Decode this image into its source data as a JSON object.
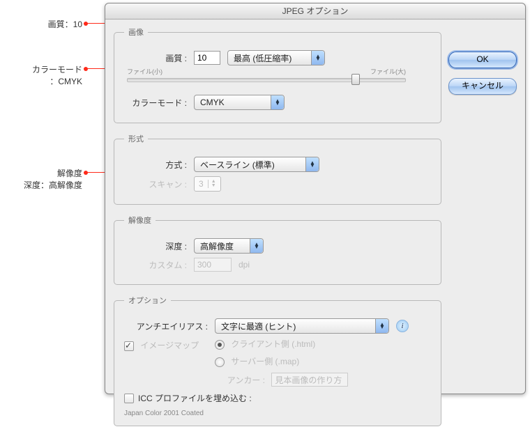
{
  "window": {
    "title": "JPEG オプション"
  },
  "callouts": {
    "quality": "画質：10",
    "colormode": "カラーモード\n：CMYK",
    "resolution": "解像度\n深度：高解像度"
  },
  "buttons": {
    "ok": "OK",
    "cancel": "キャンセル"
  },
  "image": {
    "legend": "画像",
    "quality_label": "画質 :",
    "quality_value": "10",
    "quality_preset": "最高 (低圧縮率)",
    "slider_small": "ファイル(小)",
    "slider_large": "ファイル(大)",
    "colormode_label": "カラーモード :",
    "colormode_value": "CMYK"
  },
  "format": {
    "legend": "形式",
    "method_label": "方式 :",
    "method_value": "ベースライン (標準)",
    "scan_label": "スキャン :",
    "scan_value": "3"
  },
  "resolution": {
    "legend": "解像度",
    "depth_label": "深度 :",
    "depth_value": "高解像度",
    "custom_label": "カスタム :",
    "custom_value": "300",
    "custom_unit": "dpi"
  },
  "options": {
    "legend": "オプション",
    "aa_label": "アンチエイリアス :",
    "aa_value": "文字に最適 (ヒント)",
    "imagemap_label": "イメージマップ",
    "imagemap_client": "クライアント側 (.html)",
    "imagemap_server": "サーバー側 (.map)",
    "anchor_label": "アンカー :",
    "anchor_value": "見本画像の作り方",
    "icc_label": "ICC プロファイルを埋め込む :",
    "copyright": "Japan Color 2001 Coated"
  }
}
